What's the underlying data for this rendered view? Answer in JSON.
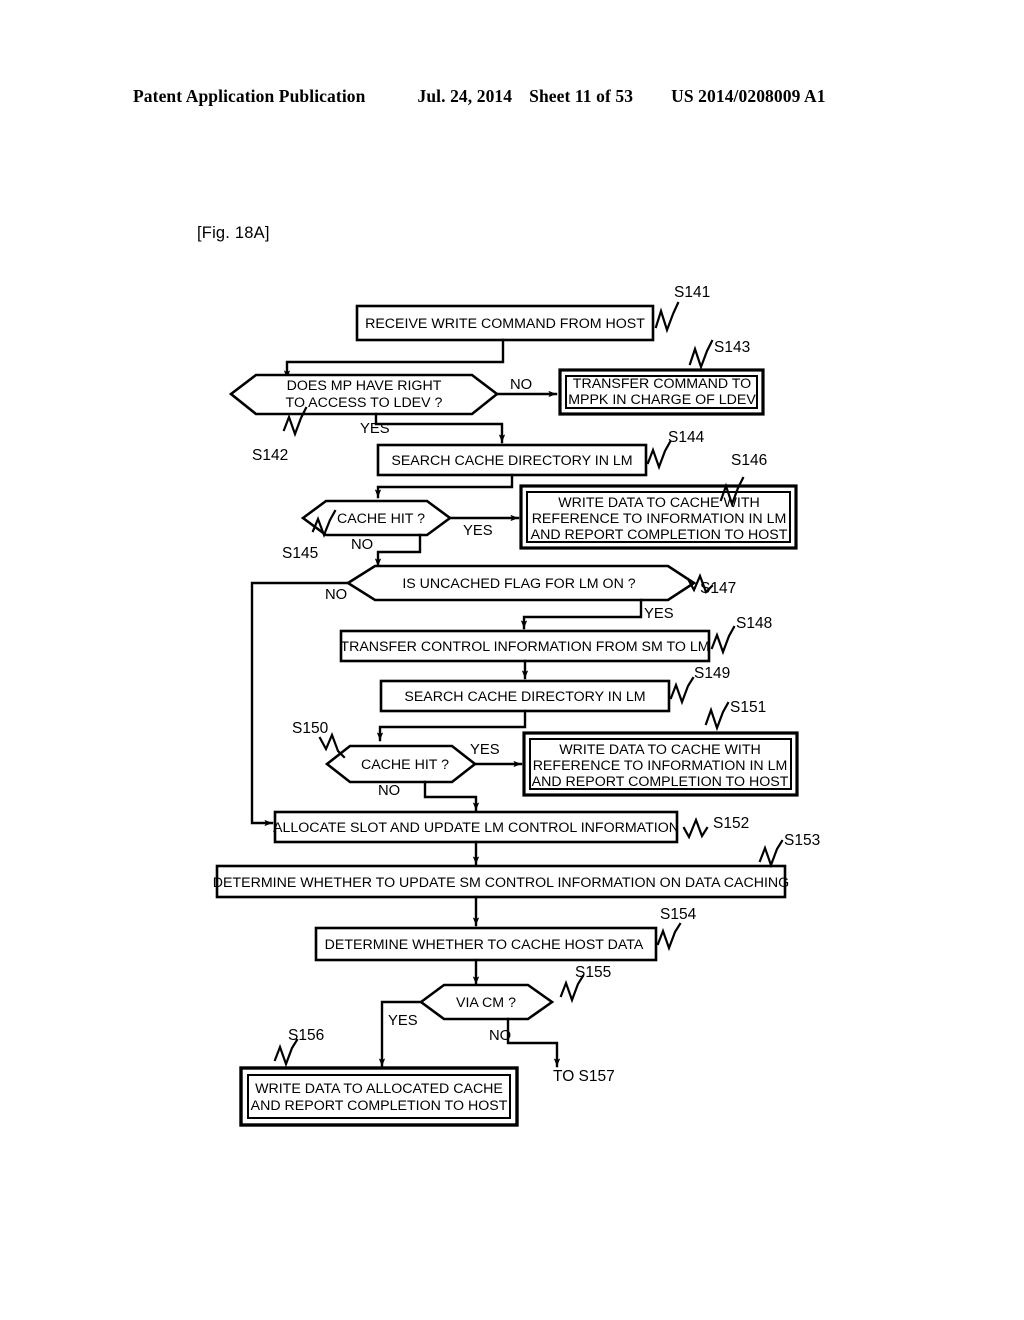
{
  "header": {
    "publication": "Patent Application Publication",
    "date": "Jul. 24, 2014",
    "sheet": "Sheet 11 of 53",
    "patent_number": "US 2014/0208009 A1"
  },
  "figure": {
    "label": "[Fig. 18A]",
    "type": "flowchart"
  },
  "nodes": {
    "s141": {
      "ref": "S141",
      "shape": "process",
      "lines": [
        "RECEIVE WRITE COMMAND FROM HOST"
      ]
    },
    "s142": {
      "ref": "S142",
      "shape": "decision",
      "lines": [
        "DOES MP HAVE RIGHT",
        "TO ACCESS TO LDEV ?"
      ]
    },
    "s143": {
      "ref": "S143",
      "shape": "process-double",
      "lines": [
        "TRANSFER COMMAND TO",
        "MPPK IN CHARGE OF LDEV"
      ]
    },
    "s144": {
      "ref": "S144",
      "shape": "process",
      "lines": [
        "SEARCH CACHE DIRECTORY IN LM"
      ]
    },
    "s145": {
      "ref": "S145",
      "shape": "decision",
      "lines": [
        "CACHE HIT ?"
      ]
    },
    "s146": {
      "ref": "S146",
      "shape": "process-double",
      "lines": [
        "WRITE DATA TO CACHE WITH",
        "REFERENCE TO INFORMATION IN LM",
        "AND REPORT COMPLETION TO HOST"
      ]
    },
    "s147": {
      "ref": "S147",
      "shape": "decision",
      "lines": [
        "IS UNCACHED FLAG FOR LM ON ?"
      ]
    },
    "s148": {
      "ref": "S148",
      "shape": "process",
      "lines": [
        "TRANSFER CONTROL INFORMATION FROM SM TO LM"
      ]
    },
    "s149": {
      "ref": "S149",
      "shape": "process",
      "lines": [
        "SEARCH CACHE DIRECTORY IN LM"
      ]
    },
    "s150": {
      "ref": "S150",
      "shape": "decision",
      "lines": [
        "CACHE HIT ?"
      ]
    },
    "s151": {
      "ref": "S151",
      "shape": "process-double",
      "lines": [
        "WRITE DATA TO CACHE WITH",
        "REFERENCE TO INFORMATION IN LM",
        "AND REPORT COMPLETION TO HOST"
      ]
    },
    "s152": {
      "ref": "S152",
      "shape": "process",
      "lines": [
        "ALLOCATE SLOT AND UPDATE LM CONTROL INFORMATION"
      ]
    },
    "s153": {
      "ref": "S153",
      "shape": "process",
      "lines": [
        "DETERMINE WHETHER TO UPDATE SM CONTROL INFORMATION ON DATA CACHING"
      ]
    },
    "s154": {
      "ref": "S154",
      "shape": "process",
      "lines": [
        "DETERMINE WHETHER TO CACHE HOST DATA"
      ]
    },
    "s155": {
      "ref": "S155",
      "shape": "decision",
      "lines": [
        "VIA CM ?"
      ]
    },
    "s156": {
      "ref": "S156",
      "shape": "process-double",
      "lines": [
        "WRITE DATA TO ALLOCATED CACHE",
        "AND REPORT COMPLETION TO HOST"
      ]
    }
  },
  "edge_labels": {
    "s142_no": "NO",
    "s142_yes": "YES",
    "s145_yes": "YES",
    "s145_no": "NO",
    "s147_no": "NO",
    "s147_yes": "YES",
    "s150_yes": "YES",
    "s150_no": "NO",
    "s155_yes": "YES",
    "s155_no": "NO"
  },
  "connector": {
    "to_s157": "TO S157"
  }
}
